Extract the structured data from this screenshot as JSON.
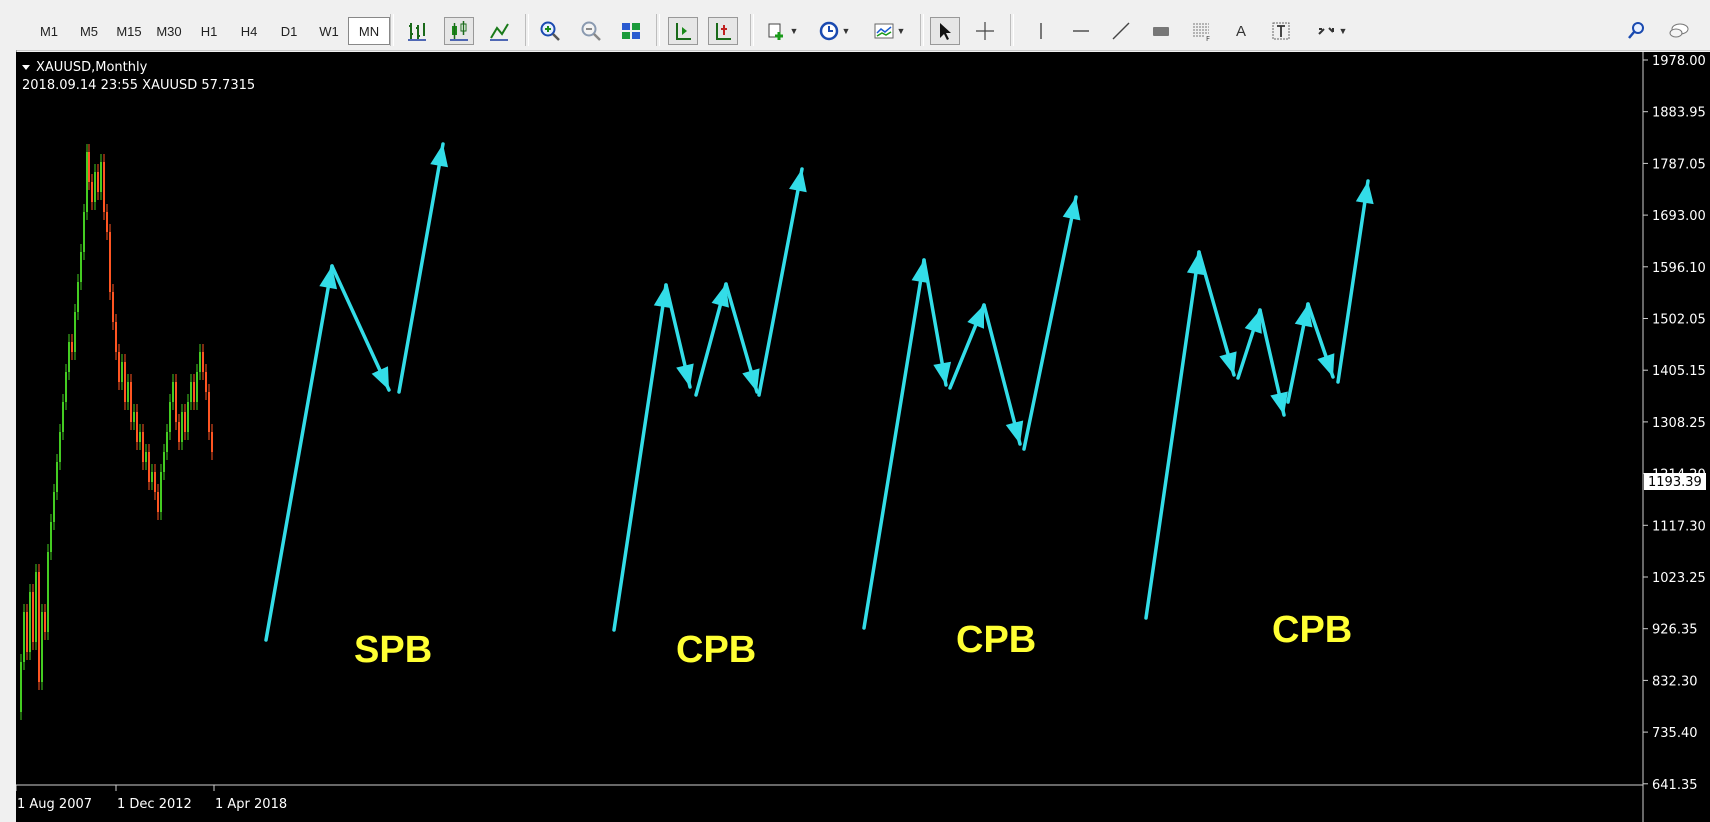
{
  "toolbar": {
    "timeframes": [
      "M1",
      "M5",
      "M15",
      "M30",
      "H1",
      "H4",
      "D1",
      "W1",
      "MN"
    ],
    "active_timeframe": "MN",
    "text_tool_label": "A"
  },
  "chart": {
    "symbol_line": "XAUUSD,Monthly",
    "crosshair_info": "2018.09.14 23:55 XAUUSD 57.7315",
    "current_price": "1193.39",
    "price_axis": [
      "1978.00",
      "1883.95",
      "1787.05",
      "1693.00",
      "1596.10",
      "1502.05",
      "1405.15",
      "1308.25",
      "1214.20",
      "1117.30",
      "1023.25",
      "926.35",
      "832.30",
      "735.40",
      "641.35"
    ],
    "date_axis": [
      "1 Aug 2007",
      "1 Dec 2012",
      "1 Apr 2018"
    ],
    "pattern_labels": [
      "SPB",
      "CPB",
      "CPB",
      "CPB"
    ],
    "colors": {
      "background": "#000000",
      "arrows": "#33dde8",
      "labels": "#ffff33",
      "candle_up": "#44cc22",
      "candle_down": "#ff5522"
    }
  }
}
